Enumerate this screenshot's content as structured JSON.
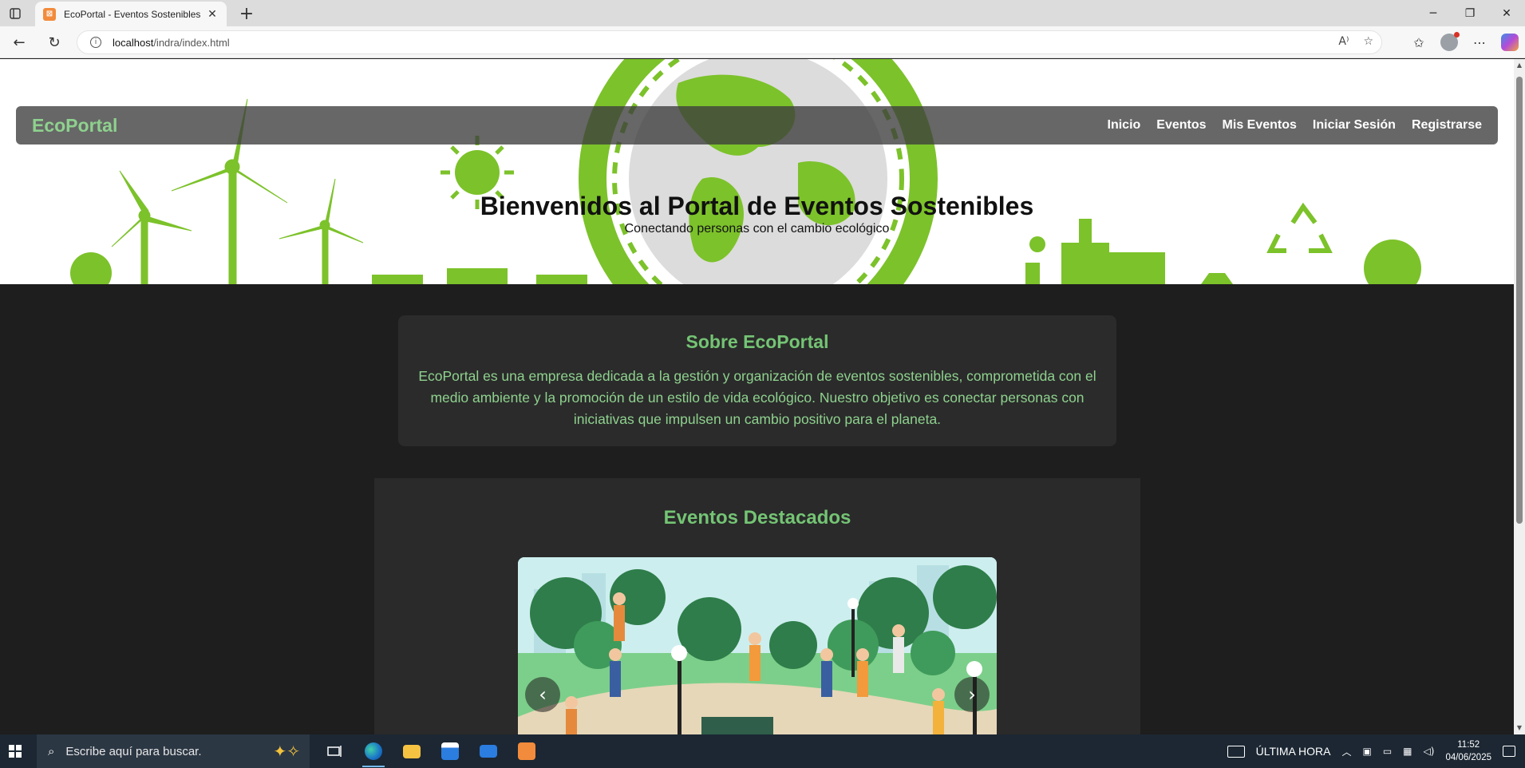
{
  "browser": {
    "tab_title": "EcoPortal - Eventos Sostenibles",
    "url_host": "localhost",
    "url_path": "/indra/index.html"
  },
  "site": {
    "brand": "EcoPortal",
    "nav": [
      {
        "label": "Inicio"
      },
      {
        "label": "Eventos"
      },
      {
        "label": "Mis Eventos"
      },
      {
        "label": "Iniciar Sesión"
      },
      {
        "label": "Registrarse"
      }
    ],
    "hero_title": "Bienvenidos al Portal de Eventos Sostenibles",
    "hero_subtitle": "Conectando personas con el cambio ecológico",
    "about_title": "Sobre EcoPortal",
    "about_text": "EcoPortal es una empresa dedicada a la gestión y organización de eventos sostenibles, comprometida con el medio ambiente y la promoción de un estilo de vida ecológico. Nuestro objetivo es conectar personas con iniciativas que impulsen un cambio positivo para el planeta.",
    "events_title": "Eventos Destacados",
    "carousel_prev": "‹",
    "carousel_next": "›"
  },
  "taskbar": {
    "search_placeholder": "Escribe aquí para buscar.",
    "news": "ÚLTIMA HORA",
    "time": "11:52",
    "date": "04/06/2025"
  },
  "colors": {
    "accent_green": "#74c474",
    "brand_green": "#8ed18e",
    "page_bg": "#1e1e1e"
  }
}
